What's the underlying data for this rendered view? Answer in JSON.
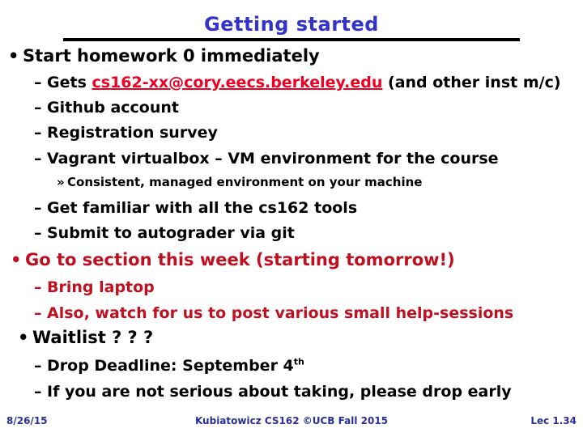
{
  "slide": {
    "title": "Getting started",
    "title_color": "#3333cc",
    "background": "#ffffff",
    "rule_color": "#000000",
    "link_color": "#ee0022",
    "accent_red": "#c01020",
    "footer_color": "#2b2f96"
  },
  "bullets": {
    "b1_marker": "•",
    "b1_text": "Start homework 0 immediately",
    "s1_marker": "–",
    "s1_prefix": "Gets ",
    "s1_link": "cs162-xx@cory.eecs.berkeley.edu",
    "s1_suffix": " (and other inst m/c)",
    "s2_marker": "–",
    "s2_text": "Github account",
    "s3_marker": "–",
    "s3_text": "Registration survey",
    "s4_marker": "–",
    "s4_text": "Vagrant virtualbox – VM environment for the course",
    "t1_marker": "»",
    "t1_text": "Consistent, managed environment on your machine",
    "s5_marker": "–",
    "s5_text": "Get familiar with all the cs162 tools",
    "s6_marker": "–",
    "s6_text": "Submit to autograder via git",
    "b2_marker": "•",
    "b2_text": "Go to section this week (starting tomorrow!)",
    "s7_marker": "–",
    "s7_text": "Bring laptop",
    "s8_marker": "–",
    "s8_text": "Also, watch for us to post various small help-sessions",
    "b3_marker": "•",
    "b3_text": "Waitlist ? ? ?",
    "s9_marker": "–",
    "s9_text_pre": "Drop Deadline: September 4",
    "s9_text_sup": "th",
    "s10_marker": "–",
    "s10_text": "If you are not serious about taking, please drop early"
  },
  "footer": {
    "date": "8/26/15",
    "center": "Kubiatowicz CS162 ©UCB Fall 2015",
    "lecture": "Lec 1.34"
  }
}
